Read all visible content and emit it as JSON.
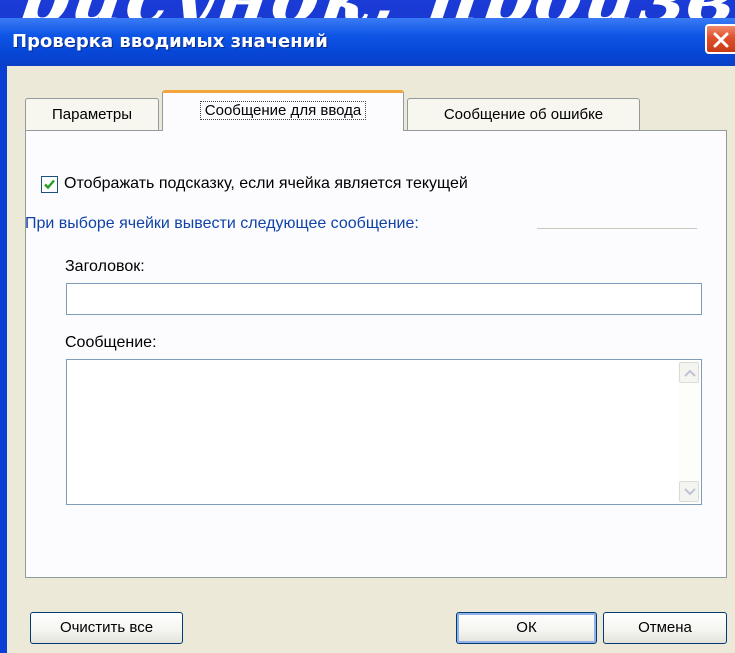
{
  "background": {
    "caption": "рисунок; произвольные значения)"
  },
  "window": {
    "title": "Проверка вводимых значений",
    "close_icon": "close-icon"
  },
  "tabs": [
    {
      "label": "Параметры",
      "active": false
    },
    {
      "label": "Сообщение для ввода",
      "active": true
    },
    {
      "label": "Сообщение об ошибке",
      "active": false
    }
  ],
  "panel": {
    "show_hint": {
      "label": "Отображать подсказку, если ячейка является текущей",
      "checked": true
    },
    "group_label": "При выборе ячейки вывести следующее сообщение:",
    "title_field": {
      "label": "Заголовок:",
      "value": ""
    },
    "message_field": {
      "label": "Сообщение:",
      "value": ""
    }
  },
  "buttons": {
    "clear_all": "Очистить все",
    "ok": "ОК",
    "cancel": "Отмена"
  },
  "colors": {
    "titlebar": "#0747d8",
    "dialog_face": "#ece9d8",
    "active_tab_accent": "#f2a53a",
    "group_label": "#1043a8"
  }
}
